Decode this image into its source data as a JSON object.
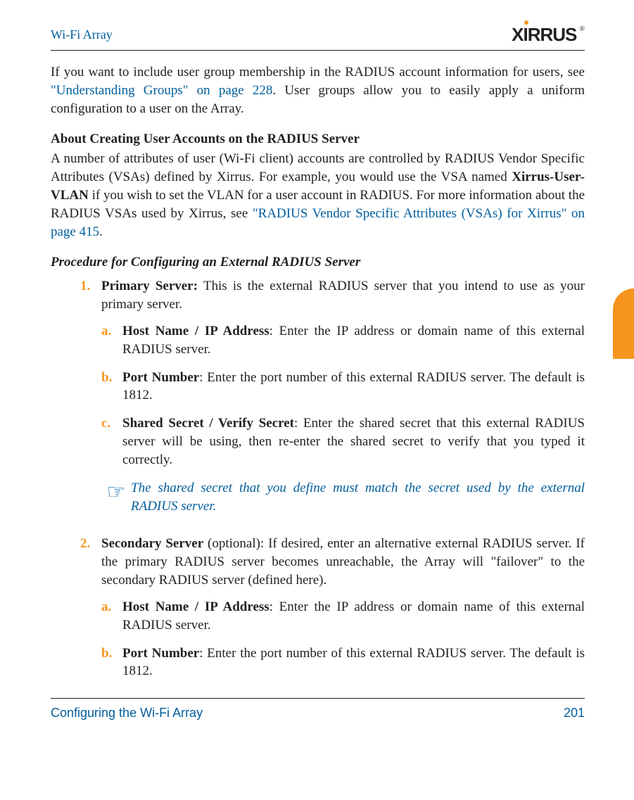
{
  "chart_data": null,
  "header": {
    "running_title": "Wi-Fi Array",
    "logo_text": "XIRRUS",
    "logo_reg": "®"
  },
  "intro": {
    "pre": "If you want to include user group membership in the RADIUS account information for users, see ",
    "link": "\"Understanding Groups\" on page 228",
    "post": ". User groups allow you to easily apply a uniform configuration to a user on the Array."
  },
  "section1": {
    "heading": "About Creating User Accounts on the RADIUS Server",
    "p_pre": "A number of attributes of user (Wi-Fi client) accounts are controlled by RADIUS Vendor Specific Attributes (VSAs) defined by Xirrus. For example, you would use the VSA named ",
    "p_bold": "Xirrus-User-VLAN",
    "p_mid": " if you wish to set the VLAN for a user account in RADIUS. For more information about the RADIUS VSAs used by Xirrus, see ",
    "p_link": "\"RADIUS Vendor Specific Attributes (VSAs) for Xirrus\" on page 415",
    "p_end": "."
  },
  "procedure": {
    "heading": "Procedure for Configuring an External RADIUS Server",
    "items": [
      {
        "num": "1.",
        "lead_bold": "Primary Server:",
        "lead_rest": " This is the external RADIUS server that you intend to use as your primary server.",
        "subs": [
          {
            "letter": "a.",
            "bold": "Host Name / IP Address",
            "rest": ": Enter the IP address or domain name of this external RADIUS server."
          },
          {
            "letter": "b.",
            "bold": "Port Number",
            "rest": ": Enter the port number of this external RADIUS server. The default is 1812."
          },
          {
            "letter": "c.",
            "bold": "Shared Secret / Verify Secret",
            "rest": ": Enter the shared secret that this external RADIUS server will be using, then re-enter the shared secret to verify that you typed it correctly."
          }
        ],
        "note": "The shared secret that you define must match the secret used by the external RADIUS server."
      },
      {
        "num": "2.",
        "lead_bold": "Secondary Server",
        "lead_rest": " (optional): If desired, enter an alternative external RADIUS server. If the primary RADIUS server becomes unreachable, the Array will \"failover\" to the secondary RADIUS server (defined here).",
        "subs": [
          {
            "letter": "a.",
            "bold": "Host Name / IP Address",
            "rest": ": Enter the IP address or domain name of this external RADIUS server."
          },
          {
            "letter": "b.",
            "bold": "Port Number",
            "rest": ": Enter the port number of this external RADIUS server. The default is 1812."
          }
        ]
      }
    ]
  },
  "footer": {
    "section": "Configuring the Wi-Fi Array",
    "page": "201"
  }
}
